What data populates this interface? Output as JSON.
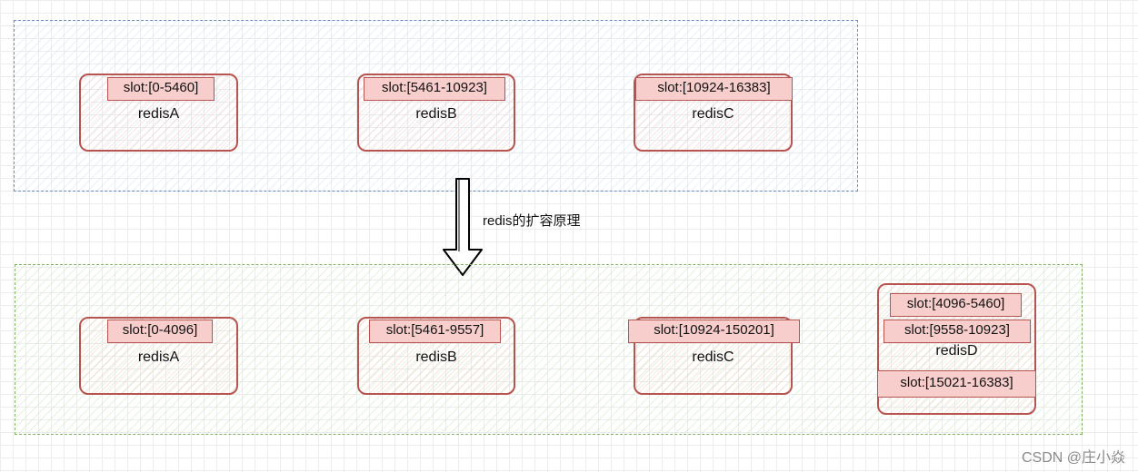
{
  "caption": "redis的扩容原理",
  "watermark": "CSDN @庄小焱",
  "colors": {
    "top_group_border": "#6c8ebf",
    "bottom_group_border": "#82b366",
    "node_border": "#b85450",
    "slot_fill": "#f8cecc"
  },
  "before": {
    "nodes": [
      {
        "name": "redisA",
        "slots": [
          "slot:[0-5460]"
        ]
      },
      {
        "name": "redisB",
        "slots": [
          "slot:[5461-10923]"
        ]
      },
      {
        "name": "redisC",
        "slots": [
          "slot:[10924-16383]"
        ]
      }
    ]
  },
  "after": {
    "nodes": [
      {
        "name": "redisA",
        "slots": [
          "slot:[0-4096]"
        ]
      },
      {
        "name": "redisB",
        "slots": [
          "slot:[5461-9557]"
        ]
      },
      {
        "name": "redisC",
        "slots": [
          "slot:[10924-150201]"
        ]
      },
      {
        "name": "redisD",
        "slots": [
          "slot:[4096-5460]",
          "slot:[9558-10923]",
          "slot:[15021-16383]"
        ]
      }
    ]
  }
}
